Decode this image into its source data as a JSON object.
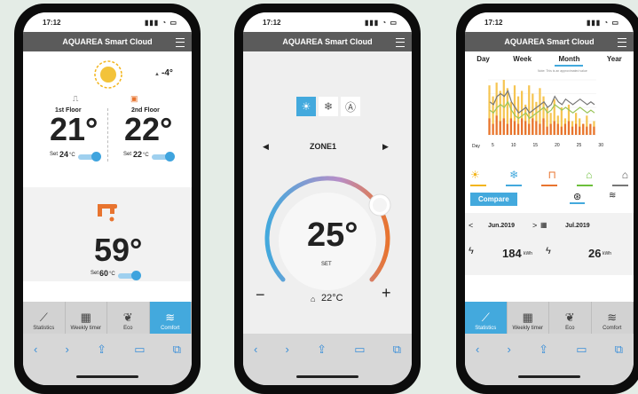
{
  "status_time": "17:12",
  "app_title": "AQUAREA Smart Cloud",
  "tabs": [
    {
      "label": "Statistics",
      "icon": "chart-icon"
    },
    {
      "label": "Weekly timer",
      "icon": "weekly-timer-icon"
    },
    {
      "label": "Eco",
      "icon": "eco-icon"
    },
    {
      "label": "Comfort",
      "icon": "comfort-icon"
    }
  ],
  "phone1": {
    "outdoor_temp": "-4°",
    "zone1": {
      "name": "1st Floor",
      "temp": "21°",
      "set_prefix": "Set",
      "set_value": "24",
      "set_unit": "°C"
    },
    "zone2": {
      "name": "2nd Floor",
      "temp": "22°",
      "set_prefix": "Set",
      "set_value": "22",
      "set_unit": "°C"
    },
    "tank": {
      "temp": "59°",
      "set_prefix": "Set",
      "set_value": "60",
      "set_unit": "°C"
    },
    "active_tab": 3
  },
  "phone2": {
    "zone_label": "ZONE1",
    "set_temp": "25°",
    "set_label": "SET",
    "room_temp": "22°C",
    "minus": "−",
    "plus": "+",
    "dial_level": 0.8
  },
  "phone3": {
    "periods": [
      "Day",
      "Week",
      "Month",
      "Year"
    ],
    "active_period": "Month",
    "note": "Note: This is an approximated value",
    "chart_x_label": "Day",
    "x_ticks": [
      "5",
      "10",
      "15",
      "20",
      "25",
      "30"
    ],
    "compare_label": "Compare",
    "prev_month": "Jun.2019",
    "next_month": "Jul.2019",
    "prev_energy": "184",
    "next_energy": "26",
    "energy_unit": "kWh",
    "active_tab": 0
  },
  "chart_data": {
    "type": "bar",
    "xlabel": "Day",
    "x_ticks": [
      "5",
      "10",
      "15",
      "20",
      "25",
      "30"
    ],
    "series": [
      {
        "values": [
          0.9,
          0.7,
          0.95,
          0.8,
          1.0,
          0.85,
          0.6,
          0.9,
          0.7,
          0.8,
          0.55,
          0.9,
          0.75,
          0.6,
          0.85,
          0.7,
          0.5,
          0.4,
          0.65,
          0.35,
          0.5,
          0.3,
          0.55,
          0.25,
          0.4,
          0.3,
          0.2,
          0.35,
          0.15,
          0.25
        ]
      },
      {
        "values": [
          0.3,
          0.2,
          0.35,
          0.25,
          0.3,
          0.2,
          0.3,
          0.25,
          0.2,
          0.3,
          0.25,
          0.2,
          0.3,
          0.25,
          0.2,
          0.3,
          0.15,
          0.2,
          0.25,
          0.2,
          0.15,
          0.2,
          0.25,
          0.15,
          0.2,
          0.15,
          0.2,
          0.15,
          0.2,
          0.15
        ]
      },
      {
        "values": [
          0.6,
          0.55,
          0.7,
          0.75,
          0.7,
          0.8,
          0.6,
          0.5,
          0.4,
          0.45,
          0.5,
          0.4,
          0.45,
          0.5,
          0.55,
          0.6,
          0.5,
          0.55,
          0.7,
          0.6,
          0.55,
          0.65,
          0.6,
          0.55,
          0.6,
          0.65,
          0.6,
          0.55,
          0.6,
          0.55
        ]
      },
      {
        "values": [
          0.45,
          0.4,
          0.5,
          0.55,
          0.5,
          0.6,
          0.45,
          0.35,
          0.3,
          0.35,
          0.4,
          0.3,
          0.35,
          0.4,
          0.45,
          0.5,
          0.4,
          0.45,
          0.55,
          0.5,
          0.45,
          0.5,
          0.45,
          0.4,
          0.45,
          0.5,
          0.45,
          0.4,
          0.45,
          0.4
        ]
      }
    ]
  },
  "colors": {
    "accent": "#43a9dd",
    "header": "#5b5b5b",
    "orange": "#e8742f",
    "sun": "#f3b51c",
    "eco": "#6cbf3b"
  }
}
